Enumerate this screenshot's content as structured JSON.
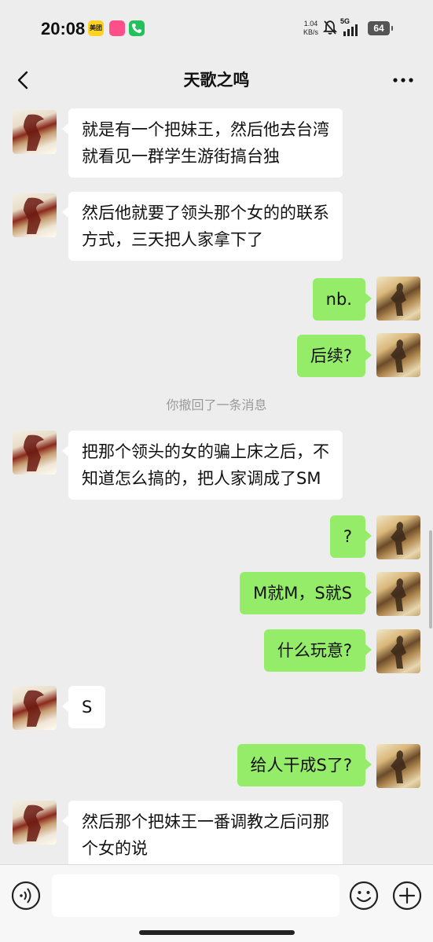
{
  "status_bar": {
    "time": "20:08",
    "app_badge_meituan": "美团",
    "net_speed_value": "1.04",
    "net_speed_unit": "KB/s",
    "network": "5G",
    "battery": "64"
  },
  "nav": {
    "title": "天歌之鸣"
  },
  "messages": [
    {
      "side": "left",
      "lines": [
        "就是有一个把妹王，然后他去台湾",
        "就看见一群学生游街搞台独"
      ]
    },
    {
      "side": "left",
      "lines": [
        "然后他就要了领头那个女的的联系",
        "方式，三天把人家拿下了"
      ]
    },
    {
      "side": "right",
      "lines": [
        "nb."
      ]
    },
    {
      "side": "right",
      "lines": [
        "后续?"
      ]
    },
    {
      "side": "left",
      "lines": [
        "把那个领头的女的骗上床之后，不",
        "知道怎么搞的，把人家调成了SM"
      ]
    },
    {
      "side": "right",
      "lines": [
        "?"
      ]
    },
    {
      "side": "right",
      "lines": [
        "M就M，S就S"
      ]
    },
    {
      "side": "right",
      "lines": [
        "什么玩意?"
      ]
    },
    {
      "side": "left",
      "lines": [
        "S"
      ]
    },
    {
      "side": "right",
      "lines": [
        "给人干成S了?"
      ]
    },
    {
      "side": "left",
      "lines": [
        "然后那个把妹王一番调教之后问那",
        "个女的说"
      ]
    }
  ],
  "system_note": "你撤回了一条消息",
  "input_bar": {
    "placeholder": ""
  },
  "colors": {
    "background": "#ededed",
    "bubble_self": "#95ec69",
    "bubble_other": "#ffffff"
  },
  "icons": {
    "back": "chevron-left-icon",
    "more": "more-icon",
    "voice": "voice-icon",
    "emoji": "emoji-icon",
    "add": "plus-icon"
  }
}
